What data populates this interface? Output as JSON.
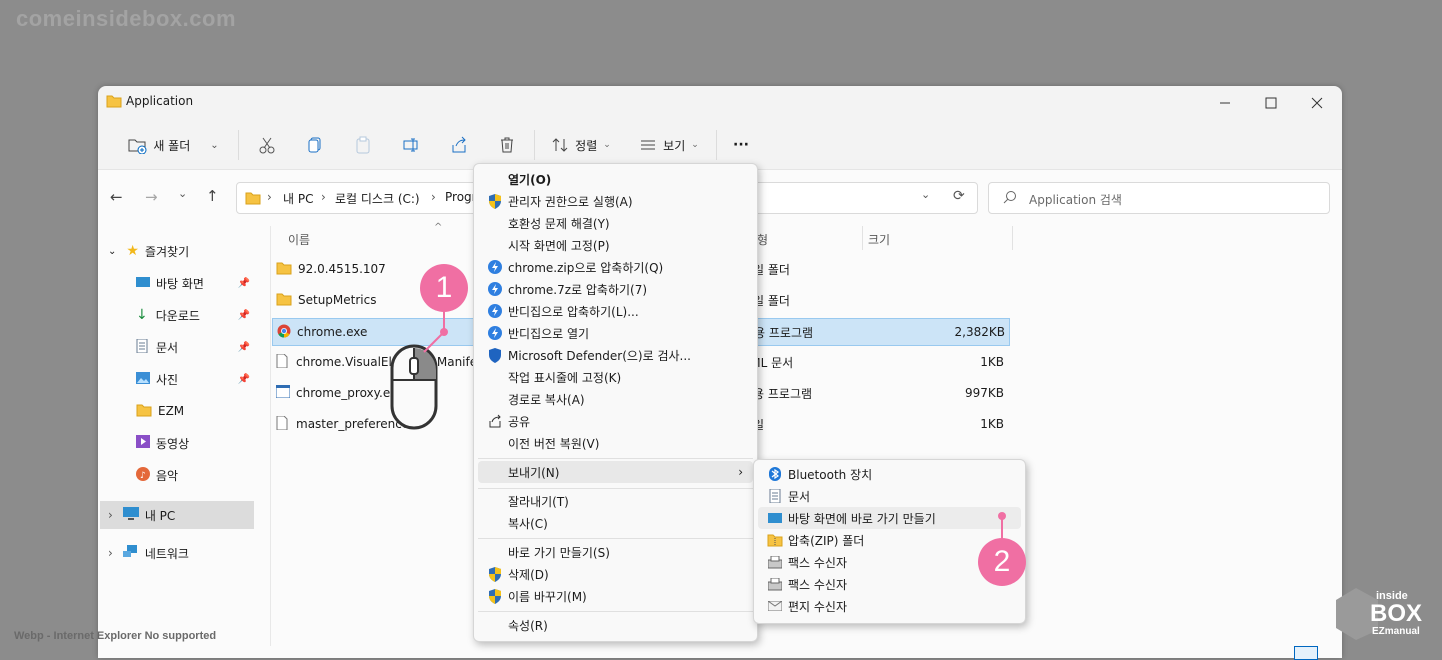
{
  "watermark": "comeinsidebox.com",
  "footer_note": "Webp - Internet Explorer No supported",
  "window": {
    "title": "Application"
  },
  "toolbar": {
    "new_folder": "새 폴더",
    "sort": "정렬",
    "view": "보기",
    "more": "···"
  },
  "address": {
    "crumbs": [
      "내 PC",
      "로컬 디스크 (C:)",
      "Progr"
    ],
    "search_placeholder": "Application 검색"
  },
  "sidebar": {
    "quick_access": "즐겨찾기",
    "items": [
      "바탕 화면",
      "다운로드",
      "문서",
      "사진",
      "EZM",
      "동영상",
      "음악"
    ],
    "this_pc": "내 PC",
    "network": "네트워크"
  },
  "columns": {
    "name": "이름",
    "type": "유형",
    "size": "크기"
  },
  "files": [
    {
      "name": "92.0.4515.107",
      "type": "파일 폴더",
      "size": ""
    },
    {
      "name": "SetupMetrics",
      "type": "파일 폴더",
      "size": ""
    },
    {
      "name": "chrome.exe",
      "type": "응용 프로그램",
      "size": "2,382KB"
    },
    {
      "name": "chrome.VisualElementsManifest.xml",
      "type": "XML 문서",
      "size": "1KB"
    },
    {
      "name": "chrome_proxy.exe",
      "type": "응용 프로그램",
      "size": "997KB"
    },
    {
      "name": "master_preferences",
      "type": "파일",
      "size": "1KB"
    }
  ],
  "context_menu": {
    "open": "열기(O)",
    "run_admin": "관리자 권한으로 실행(A)",
    "compat": "호환성 문제 해결(Y)",
    "pin_start": "시작 화면에 고정(P)",
    "zip": "chrome.zip으로 압축하기(Q)",
    "sevenz": "chrome.7z로 압축하기(7)",
    "bandizip_compress": "반디집으로 압축하기(L)...",
    "bandizip_open": "반디집으로 열기",
    "defender": "Microsoft Defender(으)로 검사...",
    "pin_taskbar": "작업 표시줄에 고정(K)",
    "copy_path": "경로로 복사(A)",
    "share": "공유",
    "restore": "이전 버전 복원(V)",
    "send_to": "보내기(N)",
    "cut": "잘라내기(T)",
    "copy": "복사(C)",
    "shortcut": "바로 가기 만들기(S)",
    "delete": "삭제(D)",
    "rename": "이름 바꾸기(M)",
    "properties": "속성(R)"
  },
  "send_to_menu": [
    "Bluetooth 장치",
    "문서",
    "바탕 화면에 바로 가기 만들기",
    "압축(ZIP) 폴더",
    "팩스 수신자",
    "팩스 수신자",
    "편지 수신자"
  ],
  "badges": [
    "1",
    "2"
  ],
  "logo": {
    "line1": "inside",
    "line2": "BOX",
    "line3": "EZmanual"
  },
  "colors": {
    "badge": "#f06fa3",
    "selection": "#cce4f7",
    "accent": "#0067c0"
  }
}
